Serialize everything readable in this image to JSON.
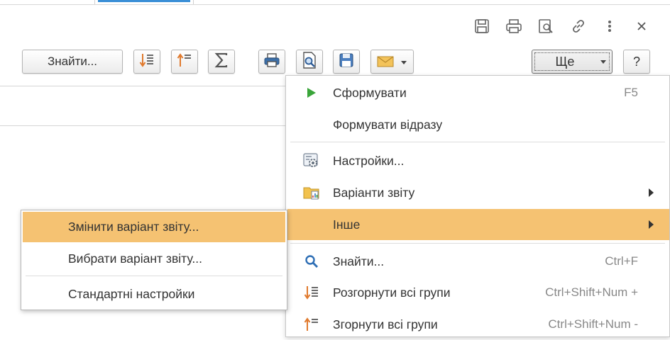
{
  "toolbar": {
    "find_label": "Знайти...",
    "more_label": "Ще",
    "help_label": "?"
  },
  "menu": {
    "items": [
      {
        "label": "Сформувати",
        "shortcut": "F5",
        "icon": "play-icon"
      },
      {
        "label": "Формувати відразу"
      },
      {
        "label": "Настройки...",
        "icon": "settings-icon"
      },
      {
        "label": "Варіанти звіту",
        "icon": "report-variants-icon",
        "submenu": true
      },
      {
        "label": "Інше",
        "submenu": true,
        "highlighted": true
      },
      {
        "label": "Знайти...",
        "shortcut": "Ctrl+F",
        "icon": "search-icon"
      },
      {
        "label": "Розгорнути всі групи",
        "shortcut": "Ctrl+Shift+Num +",
        "icon": "expand-groups-icon"
      },
      {
        "label": "Згорнути всі групи",
        "shortcut": "Ctrl+Shift+Num -",
        "icon": "collapse-groups-icon"
      }
    ]
  },
  "submenu": {
    "items": [
      {
        "label": "Змінити варіант звіту...",
        "highlighted": true
      },
      {
        "label": "Вибрати варіант звіту..."
      },
      {
        "label": "Стандартні настройки"
      }
    ]
  },
  "colors": {
    "highlight": "#f5c272",
    "accent_tab": "#3a8fd6",
    "play_green": "#3aa53a",
    "orange_icon": "#e07a2e"
  }
}
